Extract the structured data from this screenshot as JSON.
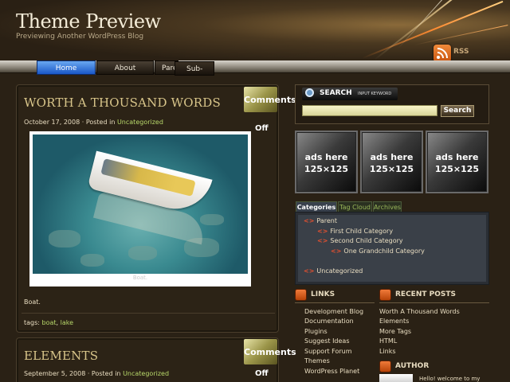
{
  "site": {
    "title": "Theme Preview",
    "description": "Previewing Another WordPress Blog",
    "rss_label": "RSS"
  },
  "nav": {
    "items": [
      {
        "label": "Home",
        "active": true
      },
      {
        "label": "About",
        "active": false
      },
      {
        "label": "Parent",
        "active": false
      },
      {
        "label": "Sub-page",
        "active": false
      }
    ]
  },
  "posts": [
    {
      "title": "WORTH A THOUSAND WORDS",
      "date": "October 17, 2008",
      "posted_in_prefix": "· Posted in",
      "category": "Uncategorized",
      "comments_label": "Comments",
      "comments_status": "Off",
      "image_caption": "Boat.",
      "text": "Boat.",
      "tags_prefix": "tags:",
      "tags": [
        "boat",
        "lake"
      ],
      "tag_separator": ","
    },
    {
      "title": "ELEMENTS",
      "date": "September 5, 2008",
      "posted_in_prefix": "· Posted in",
      "category": "Uncategorized",
      "comments_label": "Comments",
      "comments_status": "Off"
    }
  ],
  "search": {
    "title": "SEARCH",
    "hint": "INPUT KEYWORD",
    "value": "",
    "button_label": "Search"
  },
  "ads": [
    "ads here\n125×125",
    "ads here\n125×125",
    "ads here\n125×125"
  ],
  "ad_lines": {
    "line1": "ads here",
    "line2": "125×125"
  },
  "category_tabs": {
    "tabs": [
      {
        "label": "Categories",
        "active": true
      },
      {
        "label": "Tag Cloud",
        "active": false
      },
      {
        "label": "Archives",
        "active": false
      }
    ],
    "arrow": "<>",
    "items": [
      {
        "label": "Parent",
        "level": 0
      },
      {
        "label": "First Child Category",
        "level": 1
      },
      {
        "label": "Second Child Category",
        "level": 1
      },
      {
        "label": "One Grandchild Category",
        "level": 2
      },
      {
        "label": "Uncategorized",
        "level": 0
      }
    ]
  },
  "links_widget": {
    "title": "LINKS",
    "items": [
      "Development Blog",
      "Documentation",
      "Plugins",
      "Suggest Ideas",
      "Support Forum",
      "Themes",
      "WordPress Planet"
    ]
  },
  "recent_widget": {
    "title": "RECENT POSTS",
    "items": [
      "Worth A Thousand Words",
      "Elements",
      "More Tags",
      "HTML",
      "Links"
    ]
  },
  "author_widget": {
    "title": "AUTHOR",
    "text": "Hello! welcome to my"
  },
  "colors": {
    "accent_green": "#b8d86a",
    "nav_active": "#1a58c8",
    "rss_orange": "#e0601a"
  }
}
